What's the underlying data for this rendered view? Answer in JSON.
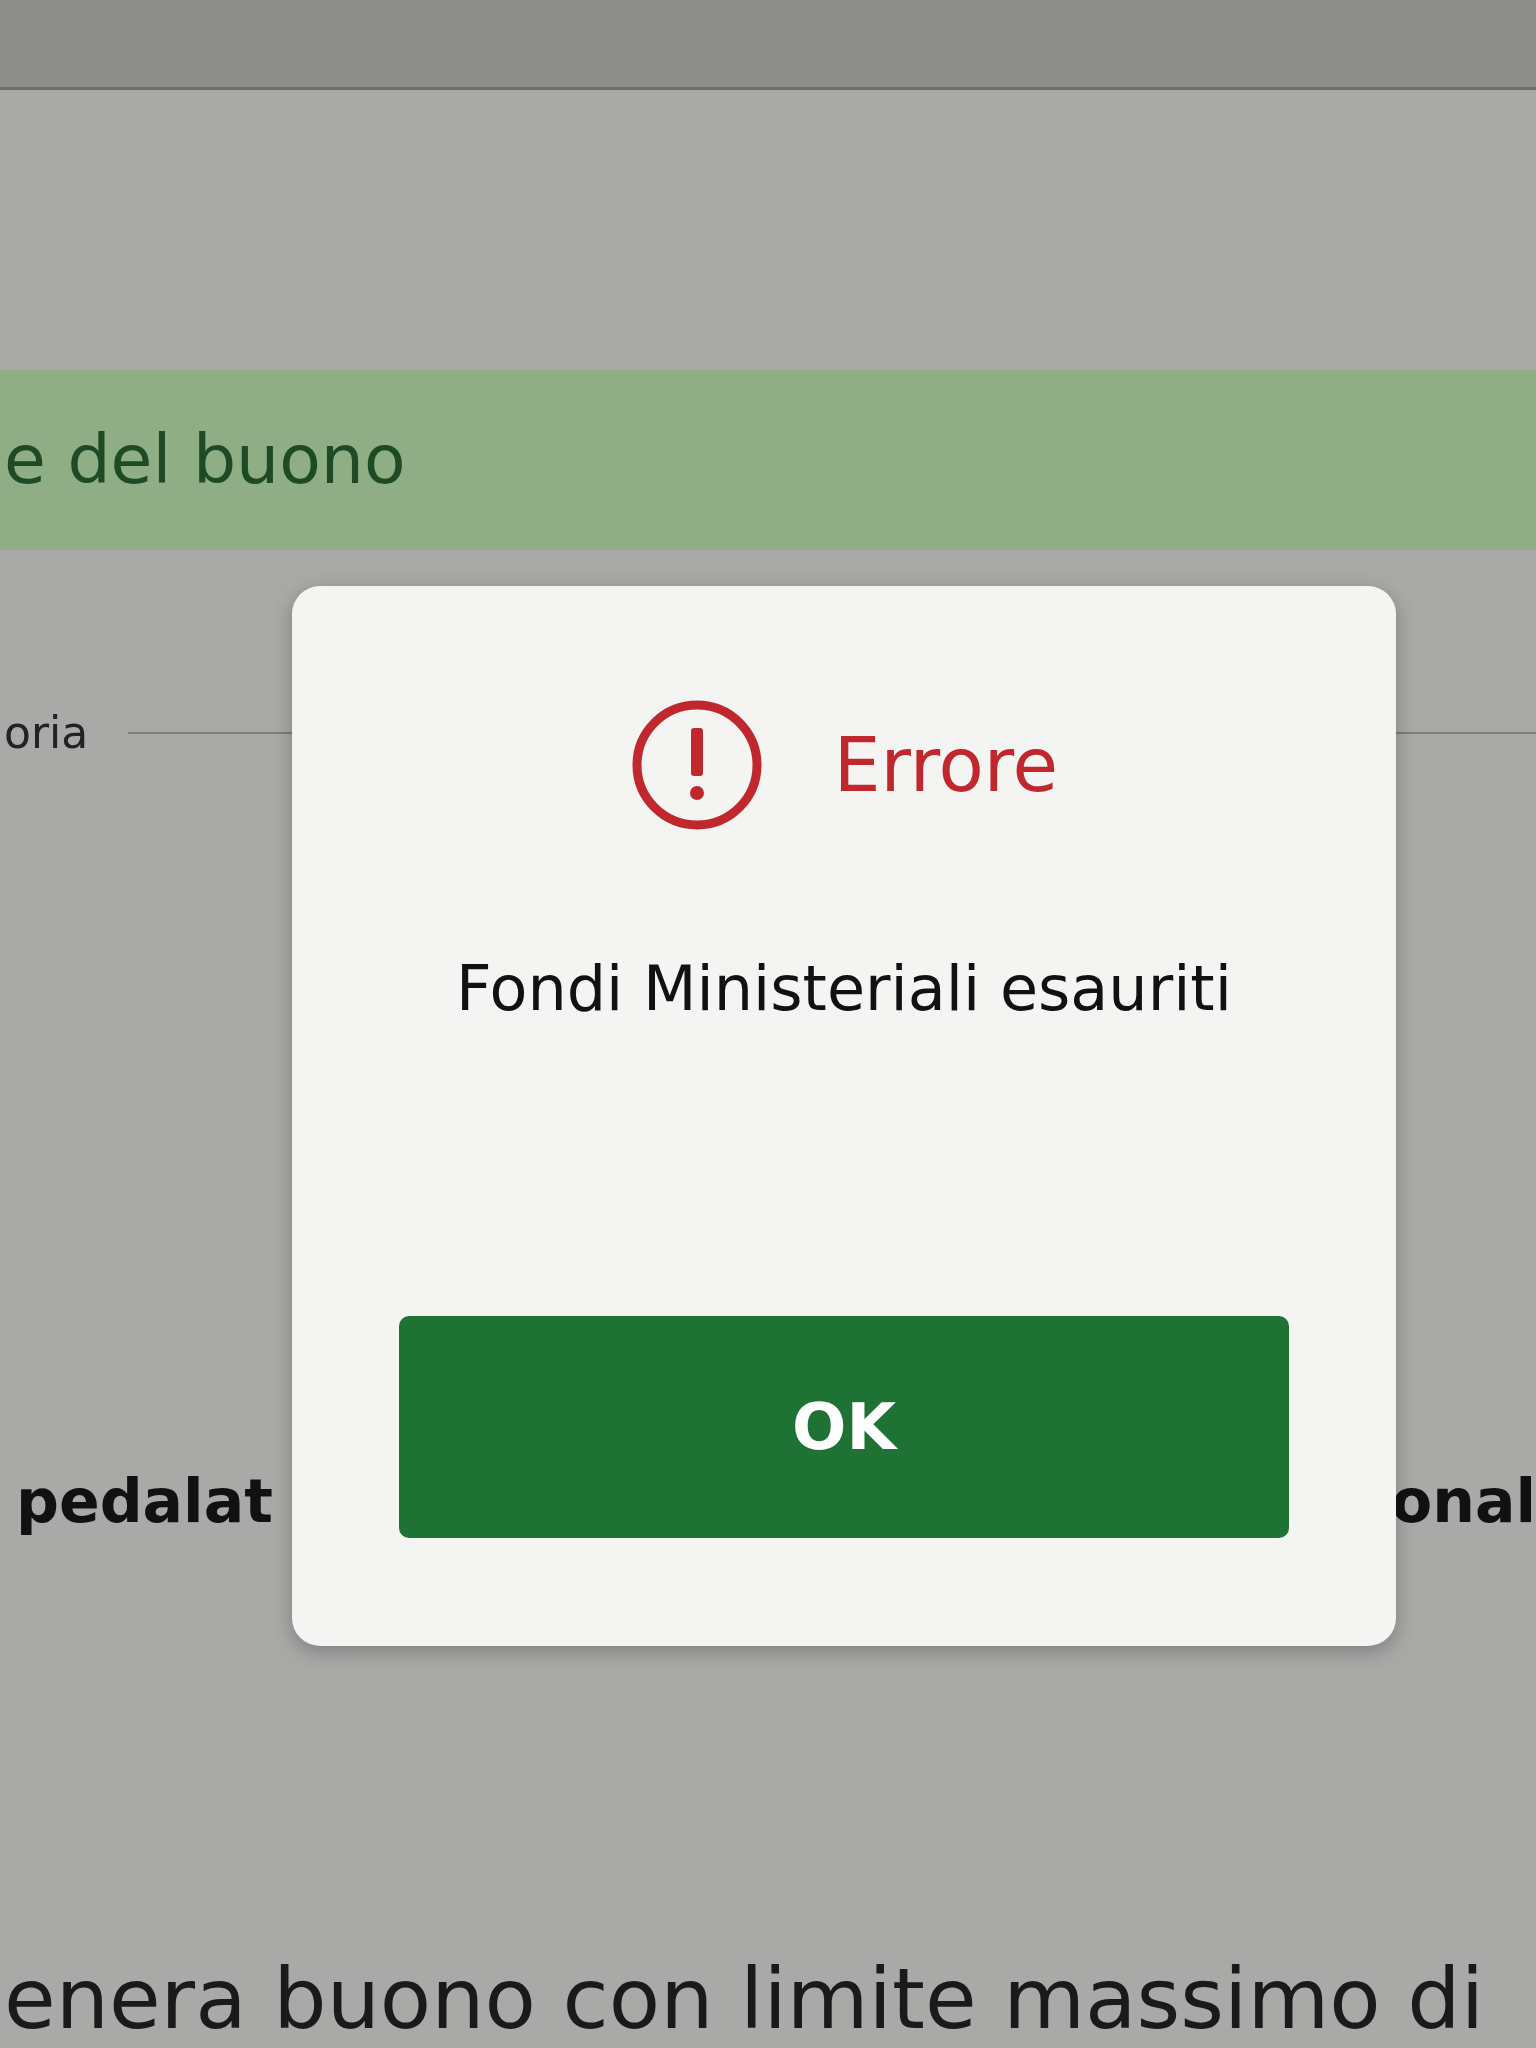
{
  "page": {
    "section_title": "e del buono",
    "field_label": "oria",
    "left_heading": "pedalat",
    "right_heading": "onal",
    "bottom_text": "enera buono con limite massimo di"
  },
  "dialog": {
    "title": "Errore",
    "message": "Fondi Ministeriali esauriti",
    "button": "OK"
  }
}
